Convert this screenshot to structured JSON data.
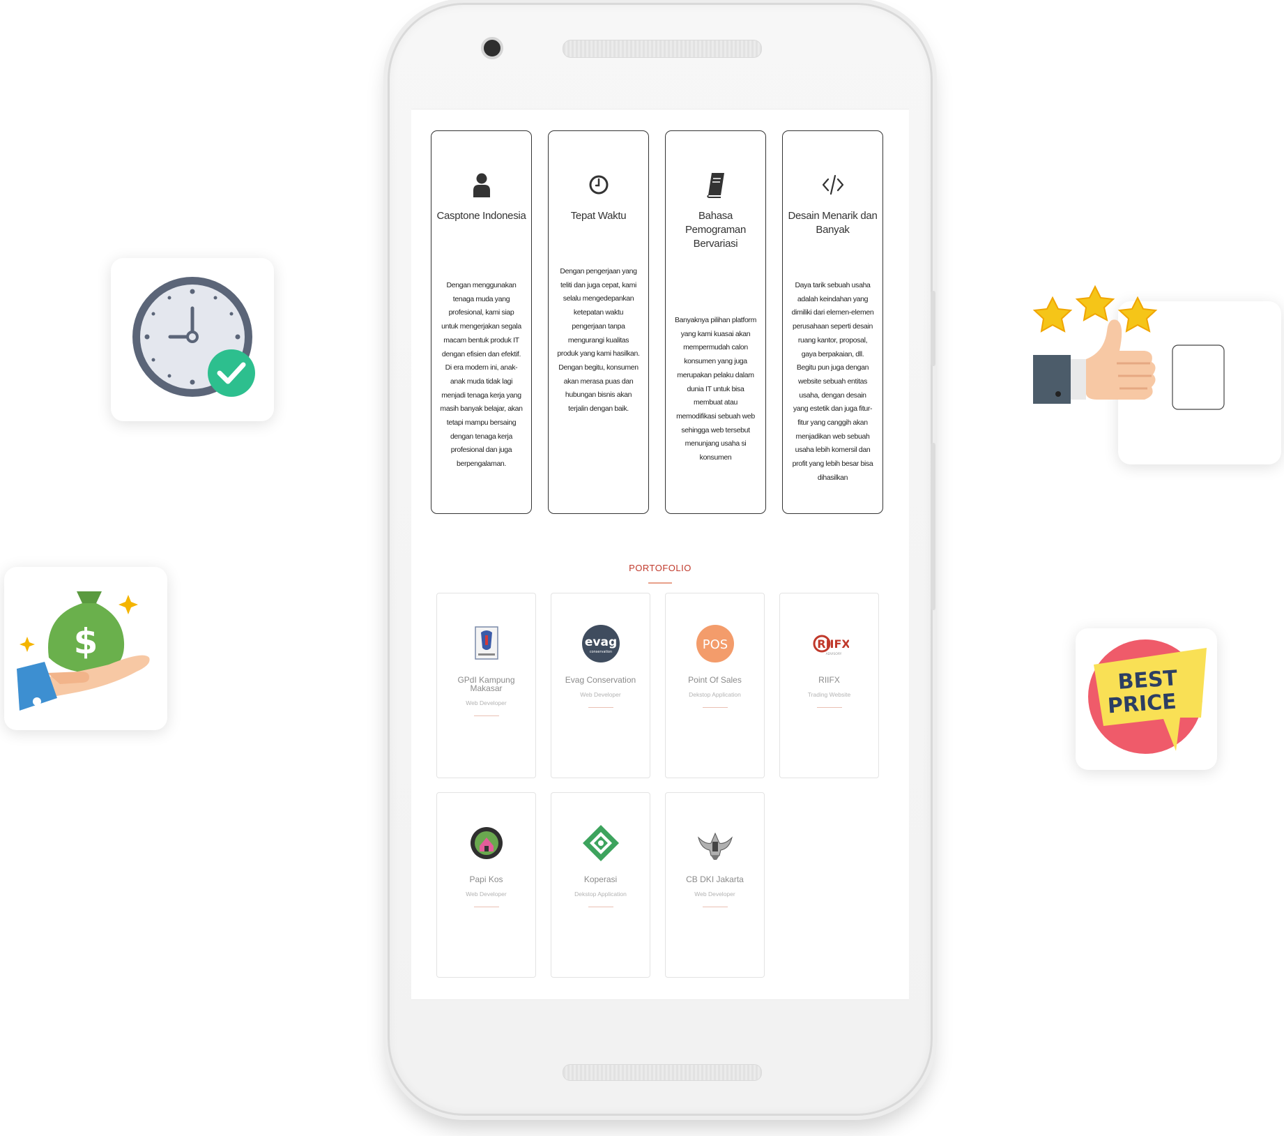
{
  "badges": {
    "clock": "clock-check-icon",
    "money": "money-bag-hand-icon",
    "rating": "thumbs-up-stars-icon",
    "price": {
      "icon": "best-price-tag-icon",
      "line1": "BEST",
      "line2": "PRICE"
    }
  },
  "features": [
    {
      "icon": "user-icon",
      "title": "Casptone Indonesia",
      "text": "Dengan menggunakan tenaga muda yang profesional, kami siap untuk mengerjakan segala macam bentuk produk IT dengan efisien dan efektif. Di era modern ini, anak-anak muda tidak lagi menjadi tenaga kerja yang masih banyak belajar, akan tetapi mampu bersaing dengan tenaga kerja profesional dan juga berpengalaman."
    },
    {
      "icon": "clock-icon",
      "title": "Tepat Waktu",
      "text": "Dengan pengerjaan yang teliti dan juga cepat, kami selalu mengedepankan ketepatan waktu pengerjaan tanpa mengurangi kualitas produk yang kami hasilkan. Dengan begitu, konsumen akan merasa puas dan hubungan bisnis akan terjalin dengan baik."
    },
    {
      "icon": "book-icon",
      "title": "Bahasa Pemograman Bervariasi",
      "text": "Banyaknya pilihan platform yang kami kuasai akan mempermudah calon konsumen yang juga merupakan pelaku dalam dunia IT untuk bisa membuat atau memodifikasi sebuah web sehingga web tersebut menunjang usaha si konsumen"
    },
    {
      "icon": "code-icon",
      "title": "Desain Menarik dan Banyak",
      "text": "Daya tarik sebuah usaha adalah keindahan yang dimiliki dari elemen-elemen perusahaan seperti desain ruang kantor, proposal, gaya berpakaian, dll. Begitu pun juga dengan website sebuah entitas usaha, dengan desain yang estetik dan juga fitur-fitur yang canggih akan menjadikan web sebuah usaha lebih komersil dan profit yang lebih besar bisa dihasilkan"
    }
  ],
  "portfolio": {
    "title": "PORTOFOLIO",
    "items": [
      {
        "name": "GPdI Kampung Makasar",
        "type": "Web Developer",
        "logo": "church-crest-logo"
      },
      {
        "name": "Evag Conservation",
        "type": "Web Developer",
        "logo": "evag-logo"
      },
      {
        "name": "Point Of Sales",
        "type": "Dekstop Application",
        "logo": "pos-logo"
      },
      {
        "name": "RIIFX",
        "type": "Trading Website",
        "logo": "riifx-logo"
      },
      {
        "name": "Papi Kos",
        "type": "Web Developer",
        "logo": "papi-kos-logo"
      },
      {
        "name": "Koperasi",
        "type": "Dekstop Application",
        "logo": "koperasi-logo"
      },
      {
        "name": "CB DKI Jakarta",
        "type": "Web Developer",
        "logo": "eagle-crest-logo"
      }
    ]
  }
}
